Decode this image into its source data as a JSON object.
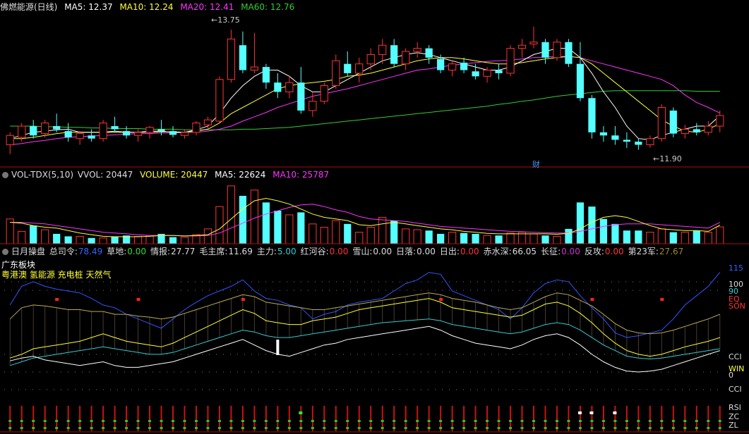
{
  "main_header": {
    "name": "佛燃能源(日线)",
    "ma5": "MA5: 12.37",
    "ma10": "MA10: 12.24",
    "ma20": "MA20: 12.41",
    "ma60": "MA60: 12.76"
  },
  "vol_header": {
    "name": "VOL-TDX(5,10)",
    "vvol": "VVOL: 20447",
    "volume": "VOLUME: 20447",
    "ma5": "MA5: 22624",
    "ma10": "MA10: 25787"
  },
  "ind_header": {
    "name": "日月操盘",
    "items": [
      {
        "label": "总司令:",
        "value": "78.49",
        "color": "#3366ff"
      },
      {
        "label": "草地:",
        "value": "0.00",
        "color": "#33dd33"
      },
      {
        "label": "情报:",
        "value": "27.77",
        "color": "#dddddd"
      },
      {
        "label": "毛主席:",
        "value": "11.69",
        "color": "#dddddd"
      },
      {
        "label": "主力:",
        "value": "5.00",
        "color": "#33cccc"
      },
      {
        "label": "红河谷:",
        "value": "0.00",
        "color": "#ff3333"
      },
      {
        "label": "雪山:",
        "value": "0.00",
        "color": "#dddddd"
      },
      {
        "label": "日落:",
        "value": "0.00",
        "color": "#dddddd"
      },
      {
        "label": "日出:",
        "value": "0.00",
        "color": "#ff3333"
      },
      {
        "label": "赤水深:",
        "value": "66.05",
        "color": "#dddddd"
      },
      {
        "label": "长征:",
        "value": "0.00",
        "color": "#cc33cc"
      },
      {
        "label": "反攻:",
        "value": "0.00",
        "color": "#ff3333"
      },
      {
        "label": "第23军:",
        "value": "27.67",
        "color": "#998833"
      }
    ]
  },
  "sector": {
    "title": "广东板块",
    "concepts": "粤港澳 氢能源 充电桩 天然气"
  },
  "annotations": {
    "high": "13.75",
    "low": "11.90",
    "event": "财"
  },
  "ind_axis": {
    "v115": "115",
    "v100": "100",
    "v90": "90",
    "eq": "EQ",
    "son": "SON",
    "cci1": "CCI",
    "win": "WIN",
    "v0": "0",
    "cci2": "CCI",
    "rsi": "RSI",
    "zc": "ZC",
    "zl": "ZL"
  },
  "colors": {
    "up": "#ff3333",
    "down": "#54ffff",
    "ma5": "#ffffff",
    "ma10": "#ffff33",
    "ma20": "#ff33ff",
    "ma60": "#33cc33",
    "bg": "#000000",
    "divider": "#aa1111"
  },
  "chart_data": [
    {
      "type": "candlestick",
      "title": "佛燃能源(日线)",
      "ohlc": [
        [
          11.9,
          12.1,
          11.75,
          12.05
        ],
        [
          12.02,
          12.25,
          11.95,
          12.2
        ],
        [
          12.2,
          12.3,
          12.0,
          12.05
        ],
        [
          12.08,
          12.3,
          12.02,
          12.25
        ],
        [
          12.2,
          12.4,
          12.1,
          12.15
        ],
        [
          12.12,
          12.25,
          11.95,
          12.02
        ],
        [
          12.0,
          12.12,
          11.9,
          12.08
        ],
        [
          12.05,
          12.15,
          11.95,
          12.0
        ],
        [
          12.0,
          12.3,
          11.95,
          12.25
        ],
        [
          12.2,
          12.35,
          12.1,
          12.15
        ],
        [
          12.12,
          12.2,
          12.0,
          12.05
        ],
        [
          12.05,
          12.15,
          11.95,
          12.1
        ],
        [
          12.1,
          12.2,
          12.0,
          12.18
        ],
        [
          12.15,
          12.3,
          12.05,
          12.12
        ],
        [
          12.12,
          12.2,
          12.02,
          12.06
        ],
        [
          12.05,
          12.15,
          12.0,
          12.1
        ],
        [
          12.1,
          12.28,
          12.05,
          12.25
        ],
        [
          12.22,
          12.35,
          12.15,
          12.3
        ],
        [
          12.28,
          13.0,
          12.25,
          12.95
        ],
        [
          12.95,
          13.75,
          12.9,
          13.6
        ],
        [
          13.5,
          13.72,
          13.05,
          13.1
        ],
        [
          13.1,
          13.7,
          13.05,
          13.15
        ],
        [
          13.15,
          13.2,
          12.8,
          12.9
        ],
        [
          12.9,
          13.05,
          12.65,
          12.75
        ],
        [
          12.75,
          13.0,
          12.65,
          12.9
        ],
        [
          12.9,
          13.15,
          12.4,
          12.45
        ],
        [
          12.45,
          12.75,
          12.35,
          12.6
        ],
        [
          12.6,
          12.9,
          12.55,
          12.85
        ],
        [
          12.85,
          13.35,
          12.8,
          13.25
        ],
        [
          13.2,
          13.4,
          13.0,
          13.05
        ],
        [
          13.05,
          13.3,
          12.9,
          13.2
        ],
        [
          13.2,
          13.45,
          13.1,
          13.35
        ],
        [
          13.35,
          13.6,
          13.2,
          13.5
        ],
        [
          13.5,
          13.6,
          13.15,
          13.2
        ],
        [
          13.2,
          13.45,
          13.1,
          13.4
        ],
        [
          13.4,
          13.55,
          13.3,
          13.45
        ],
        [
          13.45,
          13.5,
          13.2,
          13.3
        ],
        [
          13.28,
          13.35,
          13.05,
          13.1
        ],
        [
          13.1,
          13.25,
          13.0,
          13.2
        ],
        [
          13.22,
          13.3,
          13.05,
          13.1
        ],
        [
          13.08,
          13.2,
          12.95,
          13.0
        ],
        [
          13.0,
          13.15,
          12.9,
          13.1
        ],
        [
          13.1,
          13.2,
          12.95,
          13.05
        ],
        [
          13.05,
          13.5,
          13.0,
          13.45
        ],
        [
          13.45,
          13.6,
          13.3,
          13.5
        ],
        [
          13.52,
          13.8,
          13.45,
          13.55
        ],
        [
          13.55,
          13.6,
          13.2,
          13.3
        ],
        [
          13.3,
          13.6,
          13.25,
          13.55
        ],
        [
          13.55,
          13.6,
          13.15,
          13.2
        ],
        [
          13.2,
          13.55,
          12.6,
          12.65
        ],
        [
          12.65,
          12.7,
          12.0,
          12.1
        ],
        [
          12.1,
          12.2,
          11.95,
          12.05
        ],
        [
          12.05,
          12.2,
          11.9,
          11.98
        ],
        [
          11.98,
          12.1,
          11.85,
          11.95
        ],
        [
          11.95,
          12.0,
          11.82,
          11.9
        ],
        [
          11.9,
          12.05,
          11.85,
          12.0
        ],
        [
          12.0,
          12.55,
          11.95,
          12.5
        ],
        [
          12.45,
          12.5,
          12.02,
          12.08
        ],
        [
          12.08,
          12.22,
          12.0,
          12.15
        ],
        [
          12.15,
          12.25,
          12.05,
          12.1
        ],
        [
          12.1,
          12.28,
          12.05,
          12.2
        ],
        [
          12.2,
          12.45,
          12.1,
          12.37
        ]
      ],
      "ma5": [
        12.0,
        12.05,
        12.1,
        12.12,
        12.14,
        12.15,
        12.1,
        12.1,
        12.1,
        12.12,
        12.1,
        12.1,
        12.12,
        12.12,
        12.1,
        12.1,
        12.14,
        12.2,
        12.4,
        12.65,
        12.85,
        13.0,
        13.1,
        13.1,
        13.0,
        12.85,
        12.75,
        12.75,
        12.85,
        12.95,
        13.05,
        13.15,
        13.25,
        13.3,
        13.35,
        13.38,
        13.35,
        13.3,
        13.25,
        13.2,
        13.15,
        13.1,
        13.1,
        13.15,
        13.25,
        13.35,
        13.4,
        13.45,
        13.45,
        13.3,
        13.05,
        12.75,
        12.5,
        12.2,
        12.0,
        11.98,
        12.05,
        12.1,
        12.15,
        12.2,
        12.2,
        12.37
      ],
      "ma10": [
        12.0,
        12.0,
        12.02,
        12.05,
        12.08,
        12.1,
        12.1,
        12.1,
        12.1,
        12.1,
        12.1,
        12.1,
        12.1,
        12.11,
        12.11,
        12.1,
        12.12,
        12.15,
        12.25,
        12.4,
        12.5,
        12.6,
        12.7,
        12.8,
        12.85,
        12.88,
        12.9,
        12.92,
        12.95,
        13.0,
        13.02,
        13.05,
        13.1,
        13.15,
        13.2,
        13.25,
        13.28,
        13.3,
        13.3,
        13.28,
        13.25,
        13.22,
        13.2,
        13.2,
        13.22,
        13.25,
        13.28,
        13.3,
        13.32,
        13.3,
        13.2,
        13.05,
        12.9,
        12.75,
        12.6,
        12.45,
        12.3,
        12.2,
        12.12,
        12.1,
        12.15,
        12.24
      ],
      "ma20": [
        11.9,
        11.92,
        11.95,
        11.97,
        12.0,
        12.02,
        12.03,
        12.04,
        12.05,
        12.06,
        12.07,
        12.08,
        12.08,
        12.09,
        12.09,
        12.1,
        12.1,
        12.12,
        12.15,
        12.2,
        12.28,
        12.35,
        12.42,
        12.5,
        12.56,
        12.62,
        12.68,
        12.72,
        12.76,
        12.8,
        12.85,
        12.9,
        12.95,
        13.0,
        13.05,
        13.1,
        13.12,
        13.15,
        13.18,
        13.2,
        13.22,
        13.24,
        13.25,
        13.26,
        13.28,
        13.3,
        13.31,
        13.32,
        13.32,
        13.3,
        13.25,
        13.2,
        13.15,
        13.1,
        13.05,
        13.0,
        12.95,
        12.85,
        12.7,
        12.58,
        12.5,
        12.41
      ],
      "ma60": [
        12.2,
        12.2,
        12.2,
        12.19,
        12.19,
        12.18,
        12.18,
        12.17,
        12.17,
        12.16,
        12.16,
        12.16,
        12.15,
        12.15,
        12.15,
        12.14,
        12.14,
        12.14,
        12.14,
        12.14,
        12.15,
        12.15,
        12.16,
        12.17,
        12.18,
        12.2,
        12.22,
        12.24,
        12.26,
        12.28,
        12.3,
        12.32,
        12.34,
        12.36,
        12.38,
        12.4,
        12.42,
        12.44,
        12.46,
        12.48,
        12.5,
        12.52,
        12.55,
        12.57,
        12.6,
        12.62,
        12.65,
        12.68,
        12.7,
        12.72,
        12.74,
        12.76,
        12.77,
        12.77,
        12.77,
        12.77,
        12.77,
        12.77,
        12.77,
        12.76,
        12.76,
        12.76
      ],
      "ylim": [
        11.6,
        14.0
      ]
    },
    {
      "type": "bar",
      "title": "VOL-TDX(5,10)",
      "volume": [
        30000,
        15000,
        22000,
        17000,
        12000,
        9000,
        9000,
        7000,
        7000,
        9000,
        10000,
        9000,
        10000,
        12000,
        8000,
        8000,
        11000,
        18000,
        45000,
        70000,
        58000,
        65000,
        50000,
        40000,
        35000,
        38000,
        24000,
        20000,
        28000,
        24000,
        14000,
        20000,
        32000,
        28000,
        18000,
        17000,
        16000,
        12000,
        14000,
        13000,
        12000,
        10000,
        10000,
        13000,
        14000,
        12000,
        10000,
        9000,
        18000,
        50000,
        45000,
        30000,
        24000,
        16000,
        16000,
        14000,
        18000,
        14000,
        14000,
        16000,
        14000,
        20447
      ],
      "ma5": [
        26000,
        25000,
        22000,
        20000,
        19000,
        16000,
        13000,
        11000,
        9000,
        8500,
        8500,
        8500,
        9000,
        10000,
        10000,
        9500,
        10000,
        11000,
        18000,
        30000,
        42000,
        52000,
        55000,
        52000,
        48000,
        42000,
        36000,
        32000,
        30000,
        28000,
        23000,
        22000,
        24000,
        26000,
        24000,
        22000,
        20000,
        18000,
        17000,
        15000,
        14000,
        12500,
        12000,
        12000,
        12000,
        12000,
        12000,
        11500,
        12500,
        18000,
        26000,
        32000,
        34000,
        32000,
        27000,
        22000,
        18000,
        17000,
        16000,
        16000,
        15000,
        22624
      ],
      "ma10": [
        26000,
        26000,
        25000,
        24000,
        22000,
        20000,
        18000,
        16000,
        14000,
        13000,
        12000,
        11000,
        10000,
        10000,
        10000,
        9500,
        9500,
        10000,
        13000,
        19000,
        25000,
        31000,
        36000,
        40000,
        44000,
        47000,
        48000,
        45000,
        41000,
        38000,
        33000,
        30000,
        29000,
        28000,
        27000,
        25000,
        23000,
        21000,
        20000,
        19000,
        18000,
        17000,
        16000,
        15000,
        14500,
        14000,
        13500,
        13000,
        13000,
        15000,
        18000,
        21000,
        23000,
        24000,
        24000,
        24000,
        23000,
        22000,
        21000,
        20000,
        19000,
        25787
      ],
      "ylim": [
        0,
        75000
      ]
    },
    {
      "type": "line",
      "title": "日月操盘",
      "ylim": [
        0,
        115
      ],
      "series": [
        {
          "name": "总司令",
          "values": [
            75,
            95,
            100,
            95,
            92,
            90,
            88,
            82,
            75,
            72,
            65,
            60,
            55,
            50,
            60,
            70,
            78,
            85,
            90,
            95,
            102,
            90,
            82,
            80,
            75,
            72,
            60,
            65,
            68,
            75,
            78,
            80,
            82,
            90,
            98,
            102,
            110,
            108,
            90,
            85,
            80,
            75,
            70,
            60,
            72,
            88,
            98,
            102,
            100,
            85,
            72,
            60,
            45,
            40,
            42,
            45,
            48,
            60,
            75,
            85,
            95,
            110
          ]
        },
        {
          "name": "第23军",
          "values": [
            60,
            72,
            75,
            74,
            72,
            70,
            70,
            68,
            68,
            65,
            65,
            63,
            62,
            60,
            62,
            66,
            70,
            74,
            78,
            82,
            86,
            84,
            78,
            76,
            74,
            72,
            70,
            70,
            72,
            74,
            76,
            78,
            80,
            82,
            84,
            86,
            88,
            86,
            82,
            80,
            78,
            75,
            72,
            70,
            72,
            78,
            84,
            88,
            86,
            80,
            74,
            65,
            55,
            48,
            45,
            44,
            45,
            48,
            52,
            56,
            60,
            65
          ]
        },
        {
          "name": "赤水深",
          "values": [
            18,
            22,
            28,
            30,
            32,
            34,
            36,
            40,
            44,
            40,
            36,
            34,
            32,
            30,
            34,
            40,
            46,
            52,
            58,
            64,
            70,
            66,
            58,
            56,
            54,
            54,
            58,
            60,
            62,
            66,
            70,
            72,
            74,
            76,
            78,
            80,
            82,
            78,
            72,
            70,
            68,
            66,
            64,
            62,
            64,
            70,
            76,
            78,
            74,
            66,
            56,
            44,
            34,
            26,
            22,
            20,
            22,
            26,
            30,
            33,
            36,
            40
          ]
        },
        {
          "name": "主力",
          "values": [
            10,
            14,
            18,
            20,
            22,
            24,
            26,
            28,
            30,
            28,
            26,
            24,
            22,
            22,
            24,
            28,
            32,
            36,
            40,
            44,
            48,
            46,
            42,
            40,
            40,
            42,
            44,
            46,
            48,
            50,
            52,
            54,
            56,
            57,
            58,
            59,
            60,
            58,
            54,
            52,
            50,
            48,
            46,
            44,
            46,
            50,
            54,
            56,
            54,
            48,
            40,
            32,
            26,
            20,
            18,
            17,
            18,
            20,
            22,
            24,
            26,
            28
          ]
        },
        {
          "name": "情报",
          "values": [
            15,
            18,
            20,
            16,
            14,
            12,
            10,
            12,
            14,
            10,
            8,
            8,
            10,
            12,
            14,
            18,
            22,
            26,
            30,
            34,
            38,
            32,
            26,
            22,
            20,
            24,
            28,
            32,
            34,
            38,
            40,
            42,
            44,
            46,
            48,
            50,
            52,
            48,
            42,
            38,
            34,
            32,
            30,
            28,
            32,
            38,
            42,
            44,
            40,
            32,
            22,
            14,
            8,
            4,
            3,
            4,
            6,
            10,
            14,
            18,
            22,
            26
          ]
        }
      ]
    }
  ]
}
